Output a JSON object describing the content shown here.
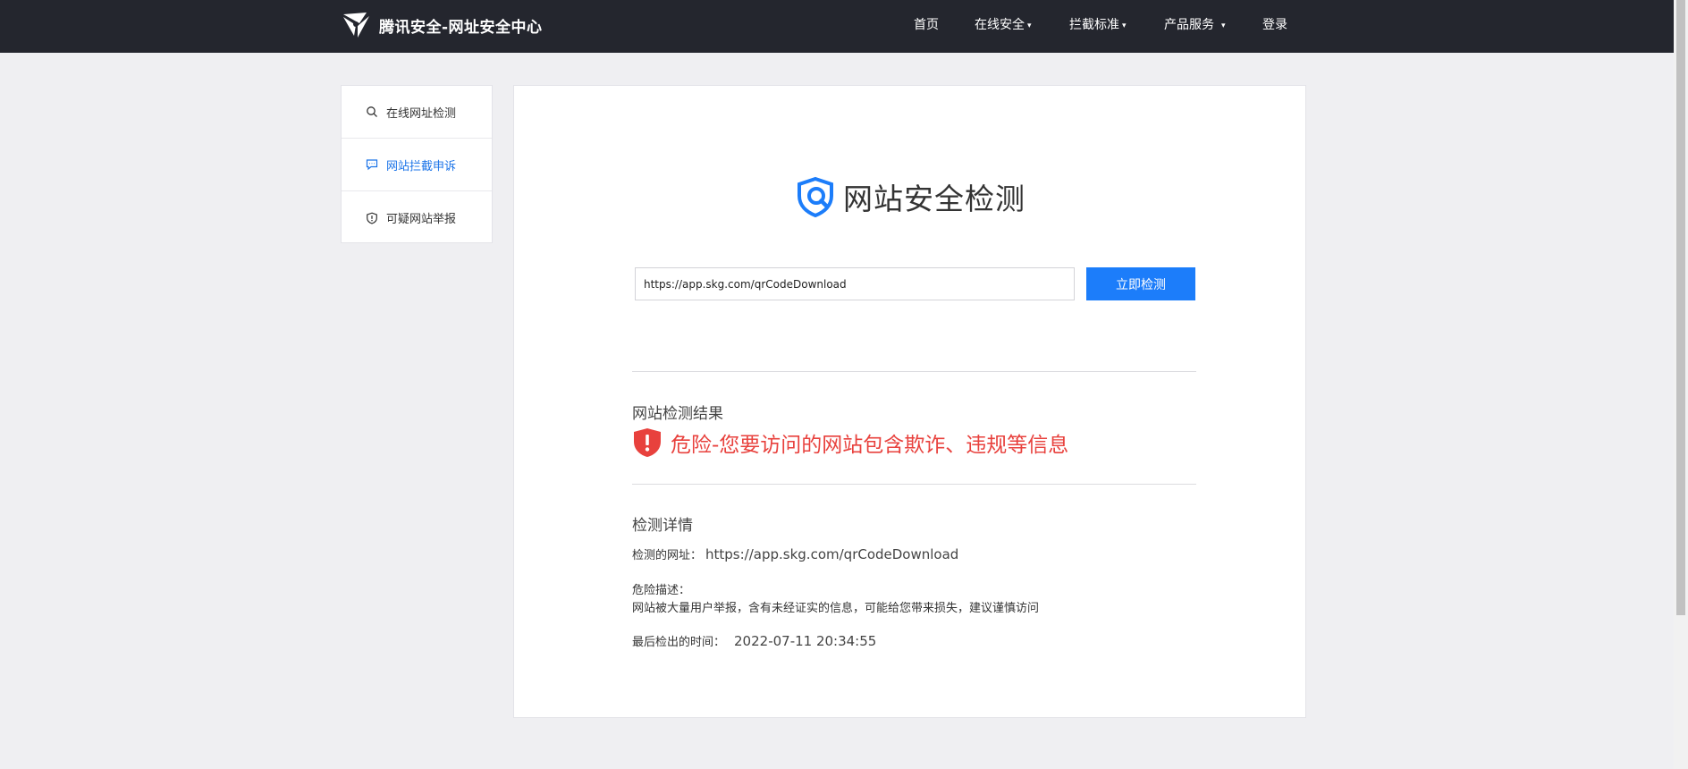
{
  "header": {
    "brand": "腾讯安全-网址安全中心",
    "nav": {
      "home": "首页",
      "online_security": "在线安全",
      "block_standard": "拦截标准",
      "products": "产品服务",
      "login": "登录",
      "caret": "▾"
    }
  },
  "sidebar": {
    "items": [
      {
        "label": "在线网址检测",
        "icon": "search-icon"
      },
      {
        "label": "网站拦截申诉",
        "icon": "message-icon"
      },
      {
        "label": "可疑网站举报",
        "icon": "shield-alert-icon"
      }
    ],
    "active_index": 1
  },
  "main": {
    "title": "网站安全检测",
    "url_input_value": "https://app.skg.com/qrCodeDownload",
    "check_button": "立即检测",
    "result_heading": "网站检测结果",
    "danger_text": "危险-您要访问的网站包含欺诈、违规等信息",
    "details_heading": "检测详情",
    "checked_url_label": "检测的网址：",
    "checked_url_value": "https://app.skg.com/qrCodeDownload",
    "risk_desc_label": "危险描述：",
    "risk_desc_value": "网站被大量用户举报，含有未经证实的信息，可能给您带来损失，建议谨慎访问",
    "last_checked_label": "最后检出的时间：",
    "last_checked_value": "2022-07-11 20:34:55"
  },
  "colors": {
    "accent": "#1c7dfa",
    "danger": "#e8413d",
    "topbar": "#24262e",
    "background": "#efeff2"
  }
}
